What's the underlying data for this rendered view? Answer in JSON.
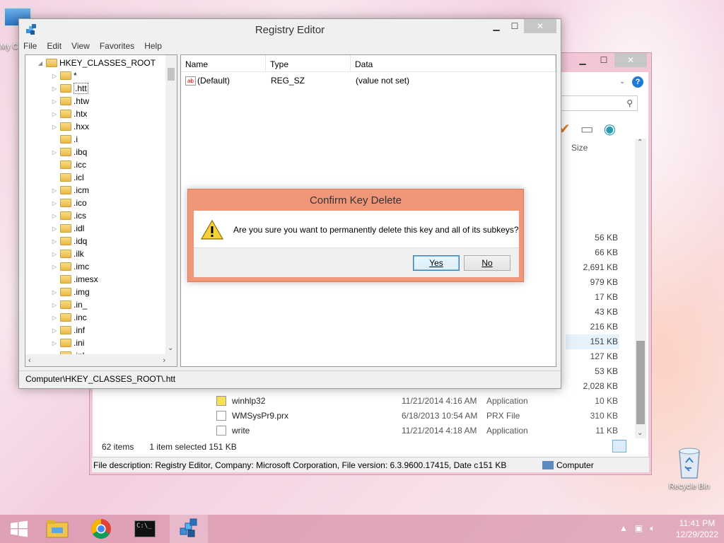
{
  "desktop": {
    "mypc_label": "My C",
    "recycle_label": "Recycle Bin"
  },
  "regedit": {
    "title": "Registry Editor",
    "menu": [
      "File",
      "Edit",
      "View",
      "Favorites",
      "Help"
    ],
    "tree_root": "HKEY_CLASSES_ROOT",
    "tree_items": [
      "*",
      ".htt",
      ".htw",
      ".htx",
      ".hxx",
      ".i",
      ".ibq",
      ".icc",
      ".icl",
      ".icm",
      ".ico",
      ".ics",
      ".idl",
      ".idq",
      ".ilk",
      ".imc",
      ".imesx",
      ".img",
      ".in_",
      ".inc",
      ".inf",
      ".ini",
      ".inl"
    ],
    "selected_item": ".htt",
    "columns": {
      "name": "Name",
      "type": "Type",
      "data": "Data"
    },
    "value_row": {
      "name": "(Default)",
      "type": "REG_SZ",
      "data": "(value not set)"
    },
    "status_path": "Computer\\HKEY_CLASSES_ROOT\\.htt"
  },
  "dialog": {
    "title": "Confirm Key Delete",
    "message": "Are you sure you want to permanently delete this key and all of its subkeys?",
    "yes_label": "Yes",
    "no_label": "No"
  },
  "explorer": {
    "size_header": "Size",
    "sizes": [
      "56 KB",
      "66 KB",
      "2,691 KB",
      "979 KB",
      "17 KB",
      "43 KB",
      "216 KB",
      "151 KB",
      "127 KB",
      "53 KB",
      "2,028 KB"
    ],
    "rows": [
      {
        "name": "winhlp32",
        "date": "11/21/2014 4:16 AM",
        "type": "Application",
        "size": "10 KB"
      },
      {
        "name": "WMSysPr9.prx",
        "date": "6/18/2013 10:54 AM",
        "type": "PRX File",
        "size": "310 KB"
      },
      {
        "name": "write",
        "date": "11/21/2014 4:18 AM",
        "type": "Application",
        "size": "11 KB"
      }
    ],
    "item_count": "62 items",
    "selection": "1 item selected  151 KB",
    "file_description": "File description: Registry Editor, Company: Microsoft Corporation, File version: 6.3.9600.17415, Date crea",
    "desc_size": "151 KB",
    "desc_location": "Computer"
  },
  "taskbar": {
    "time": "11:41 PM",
    "date": "12/29/2022"
  }
}
